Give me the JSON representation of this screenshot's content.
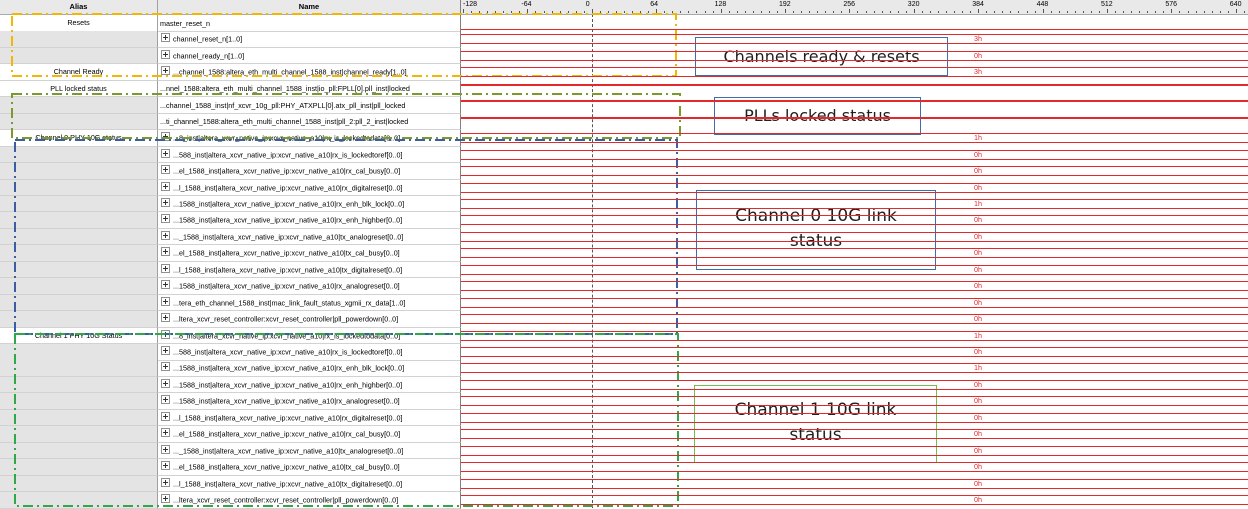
{
  "columns": {
    "alias": "Alias",
    "name": "Name"
  },
  "time_axis": {
    "ticks": [
      "-128",
      "-64",
      "0",
      "64",
      "128",
      "192",
      "256",
      "320",
      "384",
      "448",
      "512",
      "576",
      "640"
    ]
  },
  "rows": [
    {
      "alias": "Resets",
      "name": "master_reset_n",
      "expandable": false,
      "value": "",
      "lines": "single"
    },
    {
      "alias": "",
      "name": "channel_reset_n[1..0]",
      "expandable": true,
      "value": "3h",
      "lines": "bus"
    },
    {
      "alias": "",
      "name": "channel_ready_n[1..0]",
      "expandable": true,
      "value": "0h",
      "lines": "bus"
    },
    {
      "alias": "Channel Ready",
      "name": "...channel_1588:altera_eth_multi_channel_1588_inst|channel_ready[1..0]",
      "expandable": true,
      "value": "3h",
      "lines": "bus"
    },
    {
      "alias": "PLL locked status",
      "name": "...nnel_1588:altera_eth_multi_channel_1588_inst|io_pll:FPLL[0].pll_inst|locked",
      "expandable": false,
      "value": "",
      "lines": "high"
    },
    {
      "alias": "",
      "name": "...channel_1588_inst|nf_xcvr_10g_pll:PHY_ATXPLL[0].atx_pll_inst|pll_locked",
      "expandable": false,
      "value": "",
      "lines": "high"
    },
    {
      "alias": "",
      "name": "...ti_channel_1588:altera_eth_multi_channel_1588_inst|pll_2:pll_2_inst|locked",
      "expandable": false,
      "value": "",
      "lines": "high"
    },
    {
      "alias": "Channel 0 PHY 10G status",
      "name": "...8_inst|altera_xcvr_native_ip:xcvr_native_a10|rx_is_lockedtodata[0..0]",
      "expandable": true,
      "value": "1h",
      "lines": "bus"
    },
    {
      "alias": "",
      "name": "...588_inst|altera_xcvr_native_ip:xcvr_native_a10|rx_is_lockedtoref[0..0]",
      "expandable": true,
      "value": "0h",
      "lines": "bus"
    },
    {
      "alias": "",
      "name": "...el_1588_inst|altera_xcvr_native_ip:xcvr_native_a10|rx_cal_busy[0..0]",
      "expandable": true,
      "value": "0h",
      "lines": "bus"
    },
    {
      "alias": "",
      "name": "...l_1588_inst|altera_xcvr_native_ip:xcvr_native_a10|rx_digitalreset[0..0]",
      "expandable": true,
      "value": "0h",
      "lines": "bus"
    },
    {
      "alias": "",
      "name": "...1588_inst|altera_xcvr_native_ip:xcvr_native_a10|rx_enh_blk_lock[0..0]",
      "expandable": true,
      "value": "1h",
      "lines": "bus"
    },
    {
      "alias": "",
      "name": "...1588_inst|altera_xcvr_native_ip:xcvr_native_a10|rx_enh_highber[0..0]",
      "expandable": true,
      "value": "0h",
      "lines": "bus"
    },
    {
      "alias": "",
      "name": "..._1588_inst|altera_xcvr_native_ip:xcvr_native_a10|tx_analogreset[0..0]",
      "expandable": true,
      "value": "0h",
      "lines": "bus"
    },
    {
      "alias": "",
      "name": "...el_1588_inst|altera_xcvr_native_ip:xcvr_native_a10|tx_cal_busy[0..0]",
      "expandable": true,
      "value": "0h",
      "lines": "bus"
    },
    {
      "alias": "",
      "name": "...l_1588_inst|altera_xcvr_native_ip:xcvr_native_a10|tx_digitalreset[0..0]",
      "expandable": true,
      "value": "0h",
      "lines": "bus"
    },
    {
      "alias": "",
      "name": "...1588_inst|altera_xcvr_native_ip:xcvr_native_a10|rx_analogreset[0..0]",
      "expandable": true,
      "value": "0h",
      "lines": "bus"
    },
    {
      "alias": "",
      "name": "...tera_eth_channel_1588_inst|mac_link_fault_status_xgmii_rx_data[1..0]",
      "expandable": true,
      "value": "0h",
      "lines": "bus"
    },
    {
      "alias": "",
      "name": "...ltera_xcvr_reset_controller:xcvr_reset_controller|pll_powerdown[0..0]",
      "expandable": true,
      "value": "0h",
      "lines": "bus"
    },
    {
      "alias": "Channel 1 PHY  10G Status",
      "name": "...8_inst|altera_xcvr_native_ip:xcvr_native_a10|rx_is_lockedtodata[0..0]",
      "expandable": true,
      "value": "1h",
      "lines": "bus"
    },
    {
      "alias": "",
      "name": "...588_inst|altera_xcvr_native_ip:xcvr_native_a10|rx_is_lockedtoref[0..0]",
      "expandable": true,
      "value": "0h",
      "lines": "bus"
    },
    {
      "alias": "",
      "name": "...1588_inst|altera_xcvr_native_ip:xcvr_native_a10|rx_enh_blk_lock[0..0]",
      "expandable": true,
      "value": "1h",
      "lines": "bus"
    },
    {
      "alias": "",
      "name": "...1588_inst|altera_xcvr_native_ip:xcvr_native_a10|rx_enh_highber[0..0]",
      "expandable": true,
      "value": "0h",
      "lines": "bus"
    },
    {
      "alias": "",
      "name": "...1588_inst|altera_xcvr_native_ip:xcvr_native_a10|rx_analogreset[0..0]",
      "expandable": true,
      "value": "0h",
      "lines": "bus"
    },
    {
      "alias": "",
      "name": "...l_1588_inst|altera_xcvr_native_ip:xcvr_native_a10|rx_digitalreset[0..0]",
      "expandable": true,
      "value": "0h",
      "lines": "bus"
    },
    {
      "alias": "",
      "name": "...el_1588_inst|altera_xcvr_native_ip:xcvr_native_a10|rx_cal_busy[0..0]",
      "expandable": true,
      "value": "0h",
      "lines": "bus"
    },
    {
      "alias": "",
      "name": "..._1588_inst|altera_xcvr_native_ip:xcvr_native_a10|tx_analogreset[0..0]",
      "expandable": true,
      "value": "0h",
      "lines": "bus"
    },
    {
      "alias": "",
      "name": "...el_1588_inst|altera_xcvr_native_ip:xcvr_native_a10|tx_cal_busy[0..0]",
      "expandable": true,
      "value": "0h",
      "lines": "bus"
    },
    {
      "alias": "",
      "name": "...l_1588_inst|altera_xcvr_native_ip:xcvr_native_a10|tx_digitalreset[0..0]",
      "expandable": true,
      "value": "0h",
      "lines": "bus"
    },
    {
      "alias": "",
      "name": "...ltera_xcvr_reset_controller:xcvr_reset_controller|pll_powerdown[0..0]",
      "expandable": true,
      "value": "0h",
      "lines": "bus"
    }
  ],
  "callouts": {
    "resets": "Channels ready & resets",
    "pll": "PLLs locked status",
    "ch0_line1": "Channel 0 10G link",
    "ch0_line2": "status",
    "ch1_line1": "Channel 1 10G link",
    "ch1_line2": "status"
  },
  "colors": {
    "signal": "#e32929",
    "group_resets": "#f2b705",
    "group_pll": "#7a9a2c",
    "group_ch0": "#3b5ea0",
    "group_ch1": "#2fa84a"
  }
}
